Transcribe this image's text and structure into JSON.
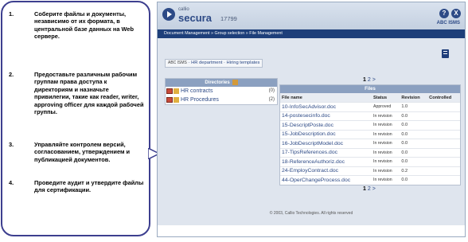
{
  "callout": {
    "items": [
      {
        "num": "1.",
        "text": "Соберите файлы и документы, независимо от их формата, в центральной базе данных на Web сервере."
      },
      {
        "num": "2.",
        "text": "Предоставьте различным рабочим группам права доступа к директориям и назначьте привилегии, такие как reader, writer, approving officer для каждой рабочей группы."
      },
      {
        "num": "3.",
        "text": "Управляйте контролем версий, согласованием, утверждением и публикацией документов."
      },
      {
        "num": "4.",
        "text": "Проведите аудит и утвердите файлы для сертификации."
      }
    ]
  },
  "app": {
    "brand_small": "callio",
    "brand": "secura",
    "brand_num": "17799",
    "help_label": "?",
    "close_label": "X",
    "abc": "ABC ISMS"
  },
  "breadcrumb": "Document Management » Group selection » File Management",
  "tab_path": {
    "root": "ABC ISMS",
    "path": "HR department · Hiring templates"
  },
  "directories": {
    "title": "Directories",
    "items": [
      {
        "label": "HR contracts",
        "count": "(0)"
      },
      {
        "label": "HR Procedures",
        "count": "(2)"
      }
    ]
  },
  "pager": {
    "current": "1",
    "next": "2",
    "arrow": ">"
  },
  "files": {
    "title": "Files",
    "columns": [
      "File name",
      "Status",
      "Revision",
      "Controlled"
    ],
    "rows": [
      [
        "10-InfoSecAdvisor.doc",
        "Approved",
        "1.0",
        ""
      ],
      [
        "14-postesecinfo.doc",
        "In revision",
        "0.0",
        ""
      ],
      [
        "15-DescriptPoste.doc",
        "In revision",
        "0.0",
        ""
      ],
      [
        "15-JobDescription.doc",
        "In revision",
        "0.0",
        ""
      ],
      [
        "16-JobDescriptModel.doc",
        "In revision",
        "0.0",
        ""
      ],
      [
        "17-TipsReferences.doc",
        "In revision",
        "0.0",
        ""
      ],
      [
        "18-ReferenceAuthoriz.doc",
        "In revision",
        "0.0",
        ""
      ],
      [
        "24-EmployContract.doc",
        "In revision",
        "0.2",
        ""
      ],
      [
        "44-OperChangeProcess.doc",
        "In revision",
        "0.0",
        ""
      ]
    ]
  },
  "footer": "© 2003, Callio Technologies. All rights reserved",
  "colors": {
    "brand": "#2d4a86",
    "breadcrumb_bg": "#1e3f7a",
    "callout_border": "#3d3f8f"
  }
}
